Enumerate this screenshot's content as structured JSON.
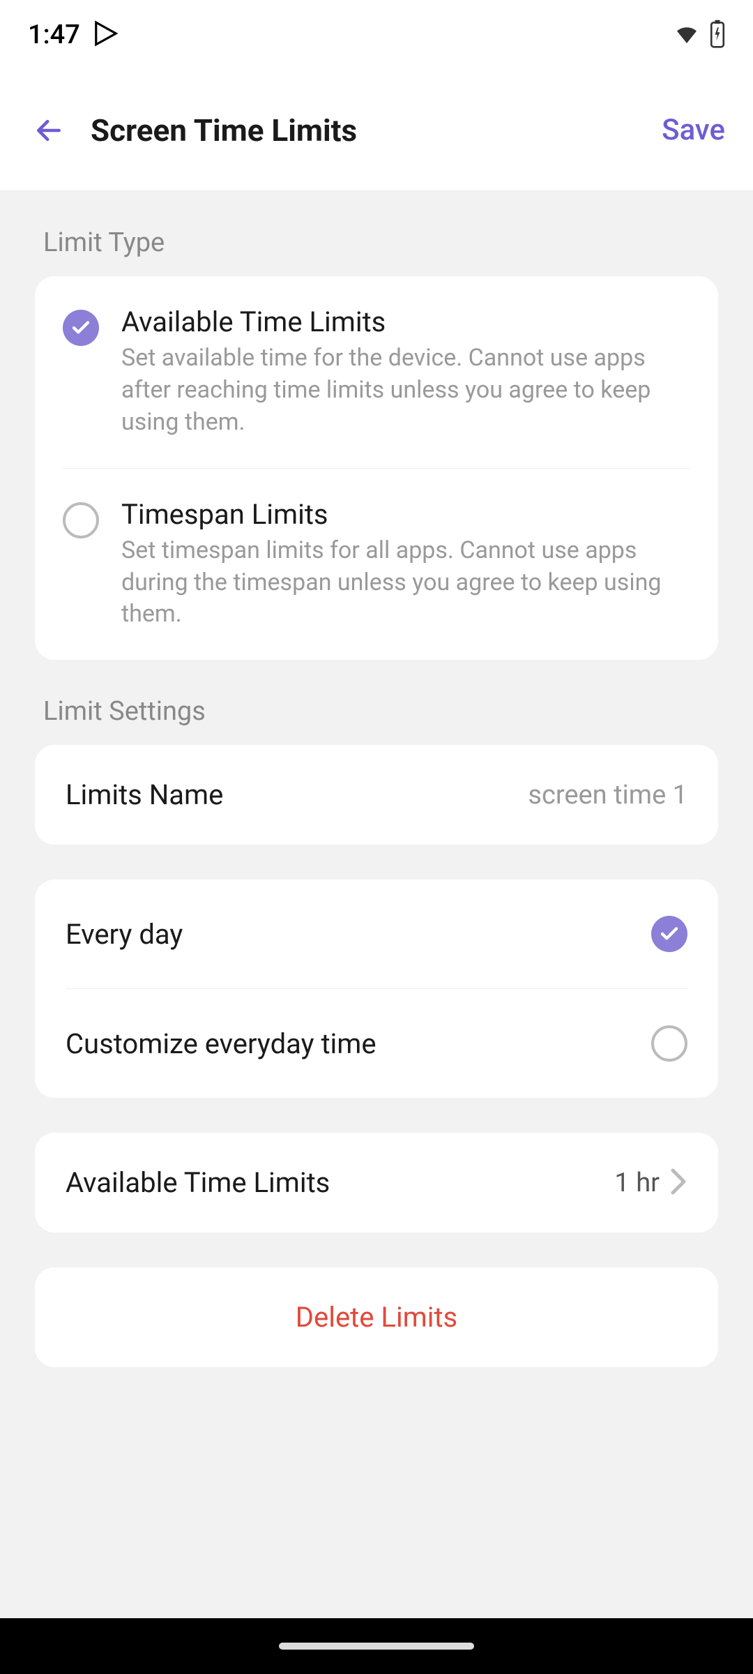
{
  "status": {
    "time": "1:47"
  },
  "header": {
    "title": "Screen Time Limits",
    "save": "Save"
  },
  "sections": {
    "limit_type": "Limit Type",
    "limit_settings": "Limit Settings"
  },
  "options": {
    "available": {
      "title": "Available Time Limits",
      "desc": "Set available time for the device. Cannot use apps after reaching time limits unless you agree to keep using them."
    },
    "timespan": {
      "title": "Timespan Limits",
      "desc": "Set timespan limits for all apps. Cannot use apps during the timespan unless you agree to keep using them."
    }
  },
  "limits_name": {
    "label": "Limits Name",
    "value": "screen time 1"
  },
  "schedule": {
    "every_day": "Every day",
    "customize": "Customize everyday time"
  },
  "time_limit": {
    "label": "Available Time Limits",
    "value": "1 hr"
  },
  "delete": "Delete Limits",
  "colors": {
    "accent": "#8b7fd8",
    "danger": "#e04a3a"
  }
}
